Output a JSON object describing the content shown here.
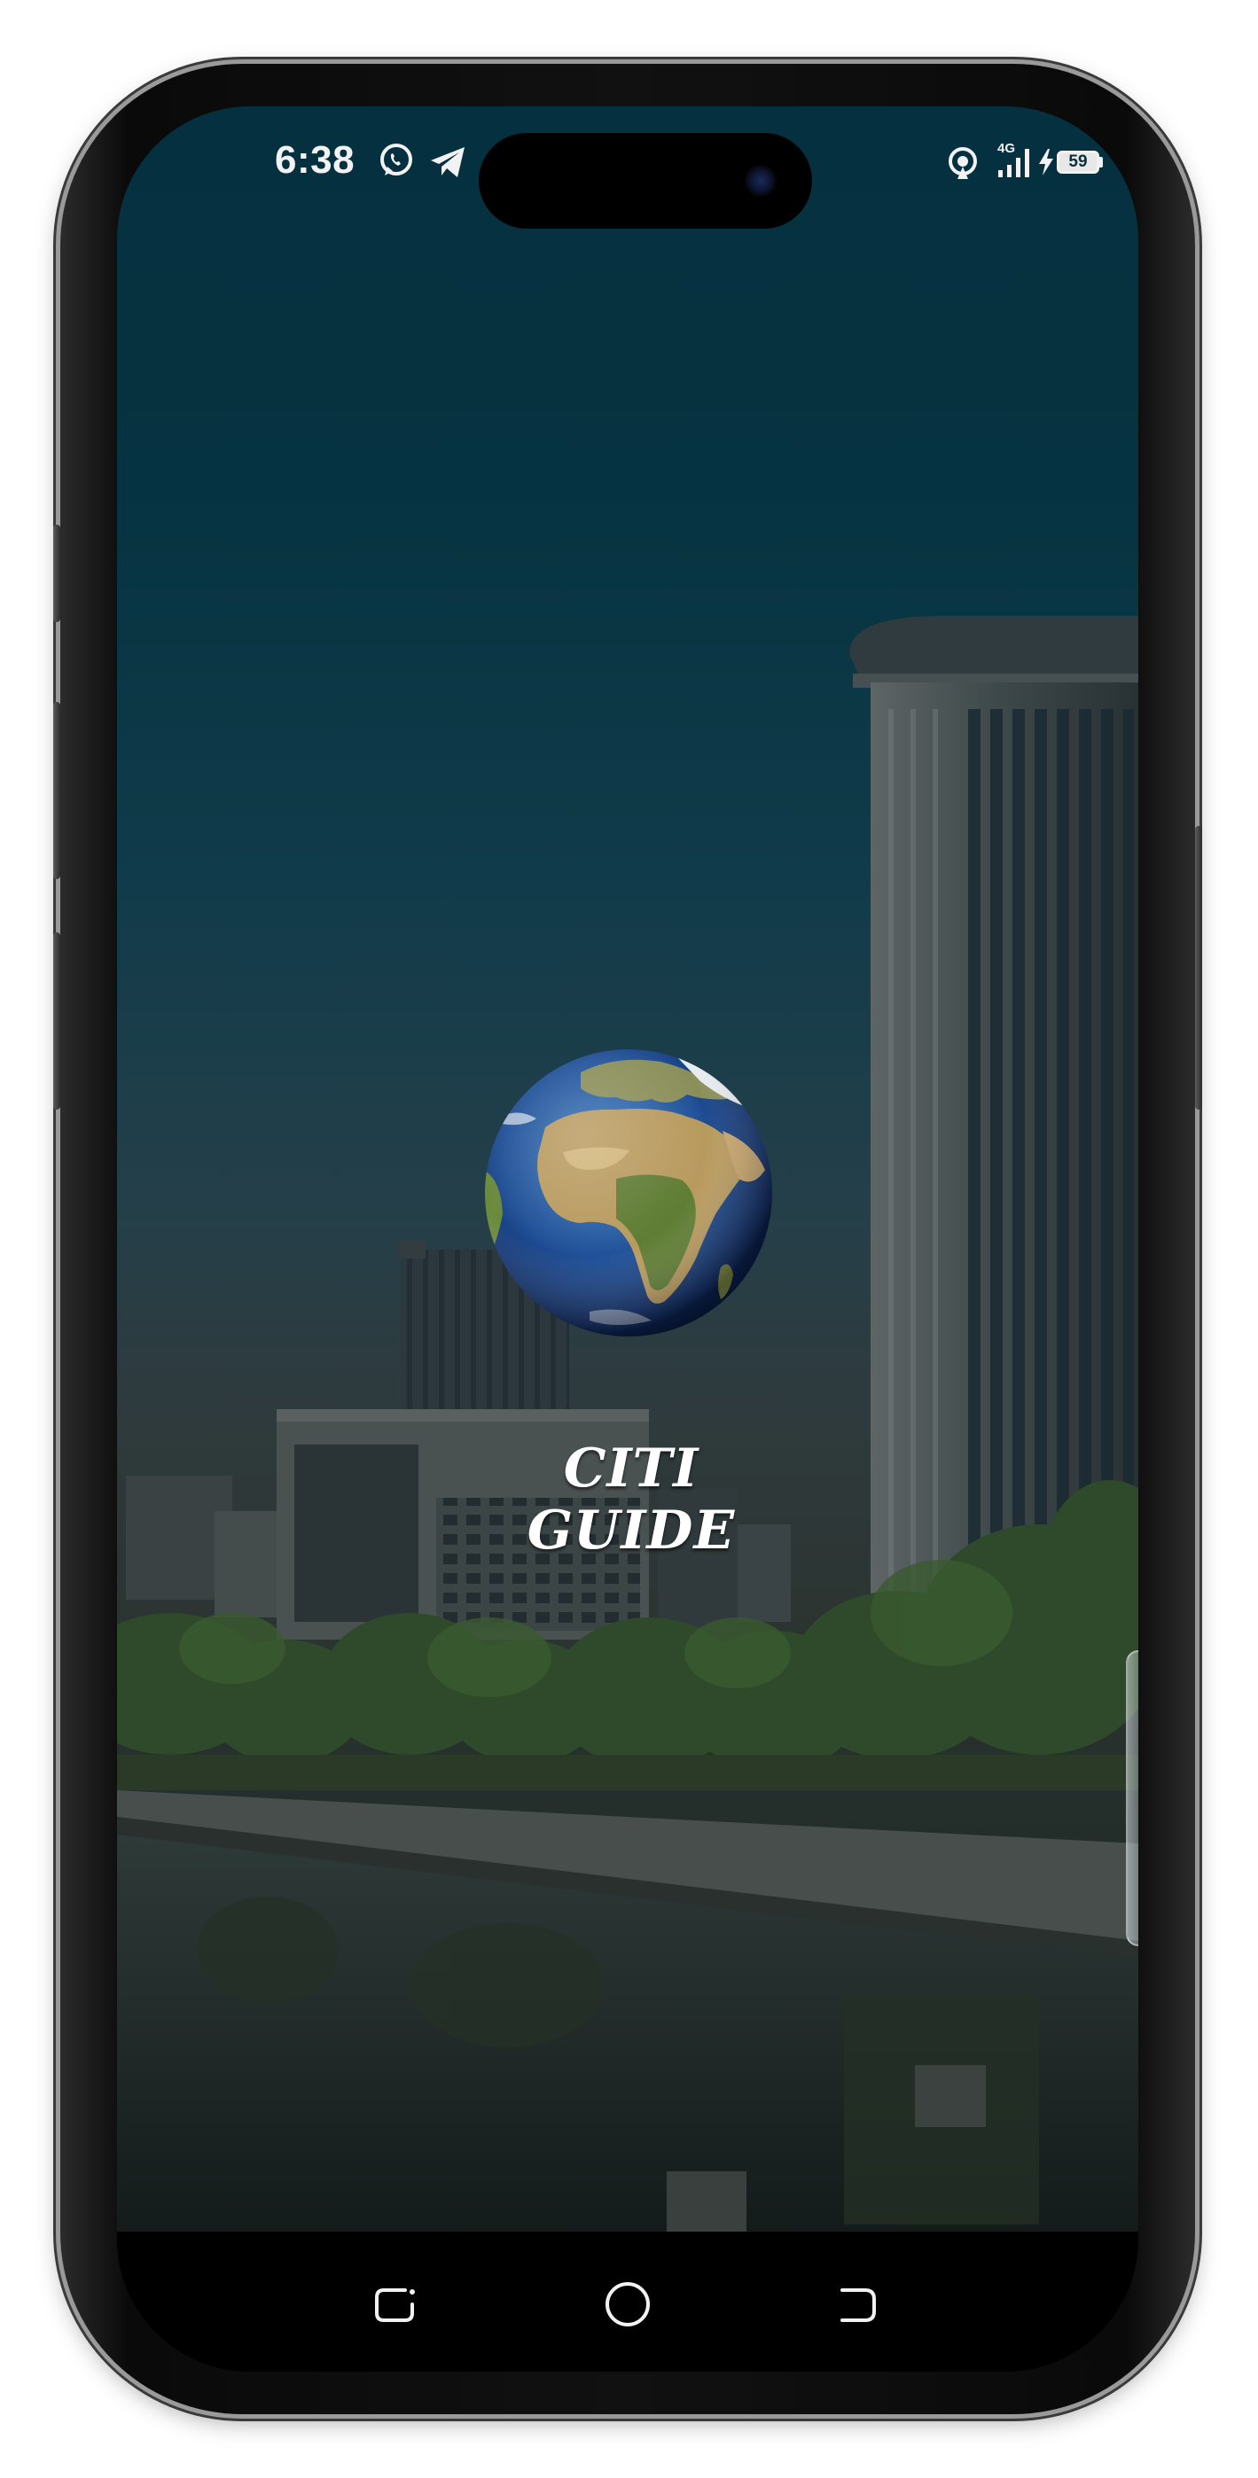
{
  "status_bar": {
    "time": "6:38",
    "left_icons": [
      "whatsapp-icon",
      "telegram-icon"
    ],
    "right_icons": [
      "hotspot-icon",
      "signal-4g-icon",
      "charging-icon",
      "battery-icon"
    ],
    "network_label": "4G",
    "battery_level": "59"
  },
  "splash": {
    "logo": "globe-logo",
    "title": "CITI GUIDE"
  },
  "navigation_bar": {
    "buttons": [
      "recents-button",
      "home-button",
      "back-button"
    ]
  },
  "colors": {
    "background_top": "#05303f",
    "background_bottom": "#18201f",
    "title_text": "#ffffff",
    "status_text": "#f2f2f2"
  }
}
